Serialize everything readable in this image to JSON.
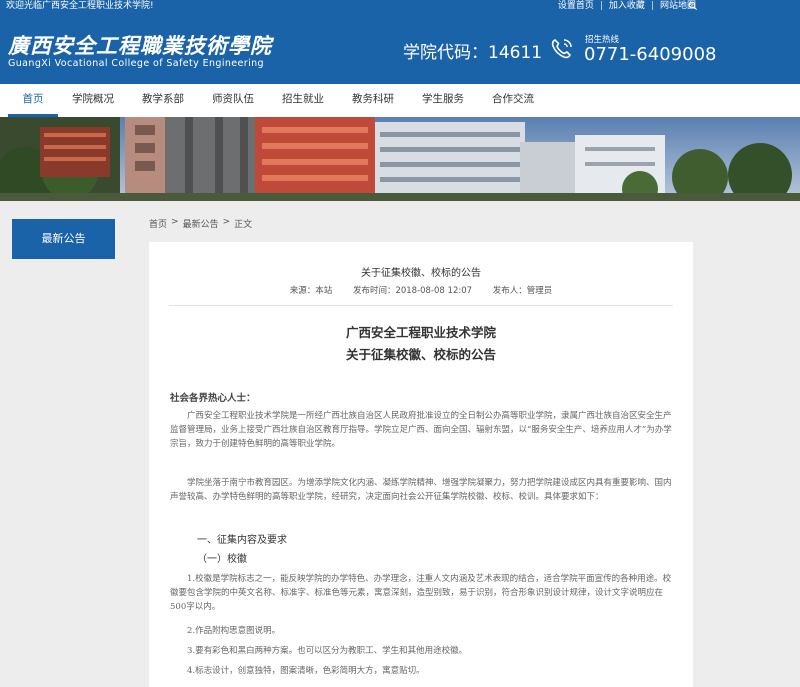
{
  "topbar": {
    "welcome": "欢迎光临广西安全工程职业技术学院!",
    "links": [
      "设置首页",
      "加入收藏",
      "网站地图"
    ],
    "search_icon": "search-icon"
  },
  "header": {
    "logo_cn": "廣西安全工程職業技術學院",
    "logo_en": "GuangXi Vocational College of Safety Engineering",
    "school_code": "学院代码：14611",
    "hotline_label": "招生热线",
    "hotline_number": "0771-6409008",
    "phone_icon": "phone-icon",
    "brand_color": "#1a63a8"
  },
  "nav": {
    "items": [
      {
        "label": "首页",
        "active": true
      },
      {
        "label": "学院概况",
        "active": false
      },
      {
        "label": "教学系部",
        "active": false
      },
      {
        "label": "师资队伍",
        "active": false
      },
      {
        "label": "招生就业",
        "active": false
      },
      {
        "label": "教务科研",
        "active": false
      },
      {
        "label": "学生服务",
        "active": false
      },
      {
        "label": "合作交流",
        "active": false
      }
    ]
  },
  "side": {
    "tab": "最新公告"
  },
  "breadcrumb": {
    "items": [
      "首页",
      "最新公告",
      "正文"
    ],
    "separator": ">"
  },
  "article": {
    "title": "关于征集校徽、校标的公告",
    "source": "来源：本站",
    "published": "发布时间：2018-08-08 12:07",
    "author": "发布人：管理员",
    "heading1": "广西安全工程职业技术学院",
    "heading2": "关于征集校徽、校标的公告",
    "salutation": "社会各界热心人士：",
    "paragraph1": "广西安全工程职业技术学院是一所经广西壮族自治区人民政府批准设立的全日制公办高等职业学院，隶属广西壮族自治区安全生产监督管理局，业务上接受广西壮族自治区教育厅指导。学院立足广西、面向全国、辐射东盟，以“服务安全生产、培养应用人才”为办学宗旨，致力于创建特色鲜明的高等职业学院。",
    "paragraph2": "学院坐落于南宁市教育园区。为增添学院文化内涵、凝练学院精神、增强学院凝聚力，努力把学院建设成区内具有重要影响、国内声誉较高、办学特色鲜明的高等职业学院，经研究，决定面向社会公开征集学院校徽、校标、校训。具体要求如下：",
    "section1": "一、征集内容及要求",
    "section2": "（一）校徽",
    "item1": "1.校徽是学院标志之一，能反映学院的办学特色、办学理念，注重人文内涵及艺术表现的结合，适合学院平面宣传的各种用途。校徽要包含学院的中英文名称、标准字、标准色等元素，寓意深刻，造型别致，易于识别，符合形象识别设计规律，设计文字说明应在500字以内。",
    "item2": "2.作品附构思意图说明。",
    "item3": "3.要有彩色和黑白两种方案。也可以区分为教职工、学生和其他用途校徽。",
    "item4": "4.标志设计，创意独特，图案清晰，色彩简明大方，寓意贴切。"
  }
}
